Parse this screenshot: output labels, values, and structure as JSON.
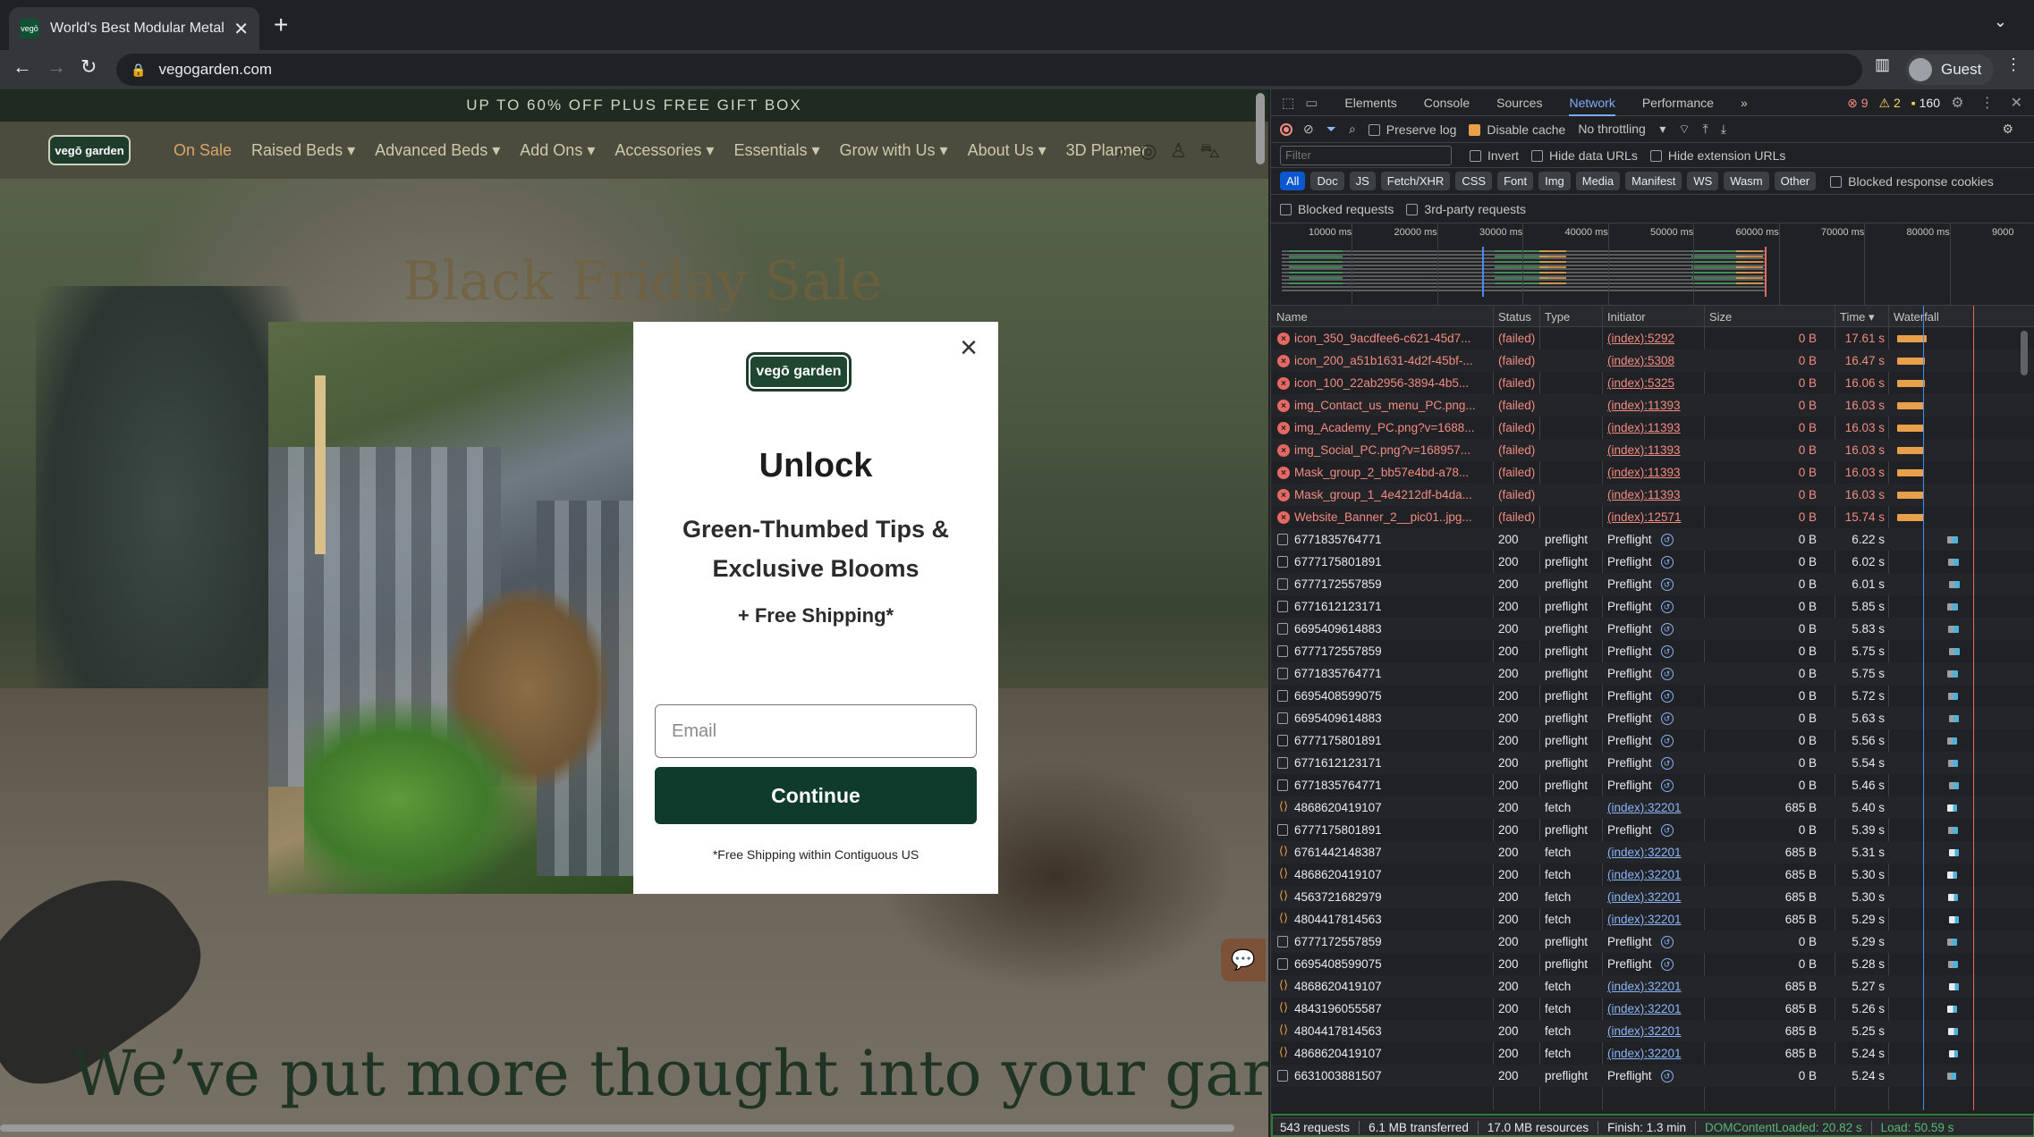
{
  "browser": {
    "tab_title": "World's Best Modular Metal R",
    "favicon_text": "vegō",
    "new_tab": "+",
    "url": "vegogarden.com",
    "profile": "Guest"
  },
  "site": {
    "promo": "UP TO 60% OFF PLUS FREE GIFT BOX",
    "logo": "vegō garden",
    "nav": [
      "On Sale",
      "Raised Beds ▾",
      "Advanced Beds ▾",
      "Add Ons ▾",
      "Accessories ▾",
      "Essentials ▾",
      "Grow with Us ▾",
      "About Us ▾",
      "3D Planner"
    ],
    "hero_title": "Black Friday Sale",
    "hero_tagline": "We’ve put more thought into your garden"
  },
  "modal": {
    "logo": "vegō garden",
    "headline": "Unlock",
    "subheadline": "Green-Thumbed Tips & Exclusive Blooms",
    "shipping": "+ Free Shipping*",
    "email_placeholder": "Email",
    "button": "Continue",
    "footnote": "*Free Shipping within Contiguous US"
  },
  "devtools": {
    "tabs": [
      "Elements",
      "Console",
      "Sources",
      "Network",
      "Performance"
    ],
    "active_tab": "Network",
    "errors": "9",
    "warnings": "2",
    "messages": "160",
    "toolbar": {
      "preserve_log": "Preserve log",
      "disable_cache": "Disable cache",
      "throttling": "No throttling"
    },
    "filter_placeholder": "Filter",
    "invert": "Invert",
    "hide_data_urls": "Hide data URLs",
    "hide_extension_urls": "Hide extension URLs",
    "type_filters": [
      "All",
      "Doc",
      "JS",
      "Fetch/XHR",
      "CSS",
      "Font",
      "Img",
      "Media",
      "Manifest",
      "WS",
      "Wasm",
      "Other"
    ],
    "blocked_response_cookies": "Blocked response cookies",
    "blocked_requests": "Blocked requests",
    "third_party": "3rd-party requests",
    "overview_ticks": [
      "10000 ms",
      "20000 ms",
      "30000 ms",
      "40000 ms",
      "50000 ms",
      "60000 ms",
      "70000 ms",
      "80000 ms",
      "9000"
    ],
    "columns": [
      "Name",
      "Status",
      "Type",
      "Initiator",
      "Size",
      "Time ▾",
      "Waterfall"
    ],
    "rows": [
      {
        "name": "icon_350_9acdfee6-c621-45d7...",
        "status": "(failed)",
        "type": "",
        "initiator": "(index):5292",
        "size": "0 B",
        "time": "17.61 s",
        "kind": "failed"
      },
      {
        "name": "icon_200_a51b1631-4d2f-45bf-...",
        "status": "(failed)",
        "type": "",
        "initiator": "(index):5308",
        "size": "0 B",
        "time": "16.47 s",
        "kind": "failed"
      },
      {
        "name": "icon_100_22ab2956-3894-4b5...",
        "status": "(failed)",
        "type": "",
        "initiator": "(index):5325",
        "size": "0 B",
        "time": "16.06 s",
        "kind": "failed"
      },
      {
        "name": "img_Contact_us_menu_PC.png...",
        "status": "(failed)",
        "type": "",
        "initiator": "(index):11393",
        "size": "0 B",
        "time": "16.03 s",
        "kind": "failed"
      },
      {
        "name": "img_Academy_PC.png?v=1688...",
        "status": "(failed)",
        "type": "",
        "initiator": "(index):11393",
        "size": "0 B",
        "time": "16.03 s",
        "kind": "failed"
      },
      {
        "name": "img_Social_PC.png?v=168957...",
        "status": "(failed)",
        "type": "",
        "initiator": "(index):11393",
        "size": "0 B",
        "time": "16.03 s",
        "kind": "failed"
      },
      {
        "name": "Mask_group_2_bb57e4bd-a78...",
        "status": "(failed)",
        "type": "",
        "initiator": "(index):11393",
        "size": "0 B",
        "time": "16.03 s",
        "kind": "failed"
      },
      {
        "name": "Mask_group_1_4e4212df-b4da...",
        "status": "(failed)",
        "type": "",
        "initiator": "(index):11393",
        "size": "0 B",
        "time": "16.03 s",
        "kind": "failed"
      },
      {
        "name": "Website_Banner_2__pic01..jpg...",
        "status": "(failed)",
        "type": "",
        "initiator": "(index):12571",
        "size": "0 B",
        "time": "15.74 s",
        "kind": "failed"
      },
      {
        "name": "6771835764771",
        "status": "200",
        "type": "preflight",
        "initiator": "Preflight",
        "size": "0 B",
        "time": "6.22 s",
        "kind": "preflight"
      },
      {
        "name": "6777175801891",
        "status": "200",
        "type": "preflight",
        "initiator": "Preflight",
        "size": "0 B",
        "time": "6.02 s",
        "kind": "preflight"
      },
      {
        "name": "6777172557859",
        "status": "200",
        "type": "preflight",
        "initiator": "Preflight",
        "size": "0 B",
        "time": "6.01 s",
        "kind": "preflight"
      },
      {
        "name": "6771612123171",
        "status": "200",
        "type": "preflight",
        "initiator": "Preflight",
        "size": "0 B",
        "time": "5.85 s",
        "kind": "preflight"
      },
      {
        "name": "6695409614883",
        "status": "200",
        "type": "preflight",
        "initiator": "Preflight",
        "size": "0 B",
        "time": "5.83 s",
        "kind": "preflight"
      },
      {
        "name": "6777172557859",
        "status": "200",
        "type": "preflight",
        "initiator": "Preflight",
        "size": "0 B",
        "time": "5.75 s",
        "kind": "preflight"
      },
      {
        "name": "6771835764771",
        "status": "200",
        "type": "preflight",
        "initiator": "Preflight",
        "size": "0 B",
        "time": "5.75 s",
        "kind": "preflight"
      },
      {
        "name": "6695408599075",
        "status": "200",
        "type": "preflight",
        "initiator": "Preflight",
        "size": "0 B",
        "time": "5.72 s",
        "kind": "preflight"
      },
      {
        "name": "6695409614883",
        "status": "200",
        "type": "preflight",
        "initiator": "Preflight",
        "size": "0 B",
        "time": "5.63 s",
        "kind": "preflight"
      },
      {
        "name": "6777175801891",
        "status": "200",
        "type": "preflight",
        "initiator": "Preflight",
        "size": "0 B",
        "time": "5.56 s",
        "kind": "preflight"
      },
      {
        "name": "6771612123171",
        "status": "200",
        "type": "preflight",
        "initiator": "Preflight",
        "size": "0 B",
        "time": "5.54 s",
        "kind": "preflight"
      },
      {
        "name": "6771835764771",
        "status": "200",
        "type": "preflight",
        "initiator": "Preflight",
        "size": "0 B",
        "time": "5.46 s",
        "kind": "preflight"
      },
      {
        "name": "4868620419107",
        "status": "200",
        "type": "fetch",
        "initiator": "(index):32201",
        "size": "685 B",
        "time": "5.40 s",
        "kind": "fetch"
      },
      {
        "name": "6777175801891",
        "status": "200",
        "type": "preflight",
        "initiator": "Preflight",
        "size": "0 B",
        "time": "5.39 s",
        "kind": "preflight"
      },
      {
        "name": "6761442148387",
        "status": "200",
        "type": "fetch",
        "initiator": "(index):32201",
        "size": "685 B",
        "time": "5.31 s",
        "kind": "fetch"
      },
      {
        "name": "4868620419107",
        "status": "200",
        "type": "fetch",
        "initiator": "(index):32201",
        "size": "685 B",
        "time": "5.30 s",
        "kind": "fetch"
      },
      {
        "name": "4563721682979",
        "status": "200",
        "type": "fetch",
        "initiator": "(index):32201",
        "size": "685 B",
        "time": "5.30 s",
        "kind": "fetch"
      },
      {
        "name": "4804417814563",
        "status": "200",
        "type": "fetch",
        "initiator": "(index):32201",
        "size": "685 B",
        "time": "5.29 s",
        "kind": "fetch"
      },
      {
        "name": "6777172557859",
        "status": "200",
        "type": "preflight",
        "initiator": "Preflight",
        "size": "0 B",
        "time": "5.29 s",
        "kind": "preflight"
      },
      {
        "name": "6695408599075",
        "status": "200",
        "type": "preflight",
        "initiator": "Preflight",
        "size": "0 B",
        "time": "5.28 s",
        "kind": "preflight"
      },
      {
        "name": "4868620419107",
        "status": "200",
        "type": "fetch",
        "initiator": "(index):32201",
        "size": "685 B",
        "time": "5.27 s",
        "kind": "fetch"
      },
      {
        "name": "4843196055587",
        "status": "200",
        "type": "fetch",
        "initiator": "(index):32201",
        "size": "685 B",
        "time": "5.26 s",
        "kind": "fetch"
      },
      {
        "name": "4804417814563",
        "status": "200",
        "type": "fetch",
        "initiator": "(index):32201",
        "size": "685 B",
        "time": "5.25 s",
        "kind": "fetch"
      },
      {
        "name": "4868620419107",
        "status": "200",
        "type": "fetch",
        "initiator": "(index):32201",
        "size": "685 B",
        "time": "5.24 s",
        "kind": "fetch"
      },
      {
        "name": "6631003881507",
        "status": "200",
        "type": "preflight",
        "initiator": "Preflight",
        "size": "0 B",
        "time": "5.24 s",
        "kind": "preflight"
      }
    ],
    "status_bar": {
      "requests": "543 requests",
      "transferred": "6.1 MB transferred",
      "resources": "17.0 MB resources",
      "finish": "Finish: 1.3 min",
      "dom_content_loaded": "DOMContentLoaded: 20.82 s",
      "load": "Load: 50.59 s"
    }
  }
}
